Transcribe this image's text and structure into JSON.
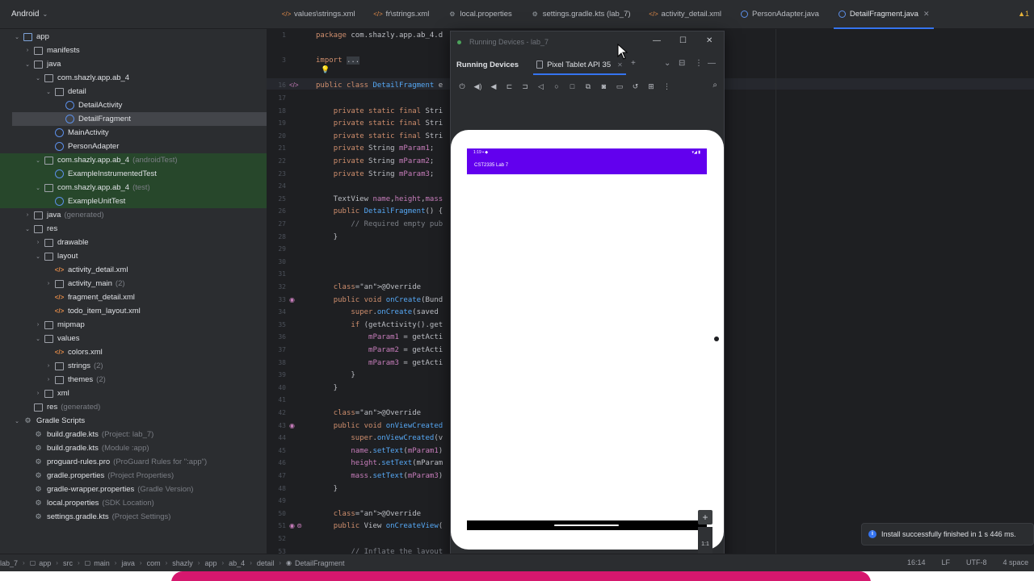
{
  "project_view": {
    "label": "Android"
  },
  "editor_tabs": [
    {
      "label": "values\\strings.xml",
      "icon": "xml-file-icon"
    },
    {
      "label": "fr\\strings.xml",
      "icon": "xml-file-icon"
    },
    {
      "label": "local.properties",
      "icon": "properties-file-icon"
    },
    {
      "label": "settings.gradle.kts (lab_7)",
      "icon": "gradle-file-icon"
    },
    {
      "label": "activity_detail.xml",
      "icon": "xml-file-icon"
    },
    {
      "label": "PersonAdapter.java",
      "icon": "java-class-icon"
    },
    {
      "label": "DetailFragment.java",
      "icon": "java-class-icon",
      "active": true
    }
  ],
  "warning_badge": "▲1",
  "tree": [
    {
      "label": "app",
      "sub": "",
      "icon": "module",
      "depth": 1,
      "arrow": "v"
    },
    {
      "label": "manifests",
      "sub": "",
      "icon": "folder",
      "depth": 2,
      "arrow": ">"
    },
    {
      "label": "java",
      "sub": "",
      "icon": "folder",
      "depth": 2,
      "arrow": "v"
    },
    {
      "label": "com.shazly.app.ab_4",
      "sub": "",
      "icon": "pkg",
      "depth": 3,
      "arrow": "v"
    },
    {
      "label": "detail",
      "sub": "",
      "icon": "pkg",
      "depth": 4,
      "arrow": "v"
    },
    {
      "label": "DetailActivity",
      "sub": "",
      "icon": "cls",
      "depth": 5,
      "arrow": ""
    },
    {
      "label": "DetailFragment",
      "sub": "",
      "icon": "cls",
      "depth": 5,
      "arrow": "",
      "selected": true
    },
    {
      "label": "MainActivity",
      "sub": "",
      "icon": "cls",
      "depth": 4,
      "arrow": ""
    },
    {
      "label": "PersonAdapter",
      "sub": "",
      "icon": "cls",
      "depth": 4,
      "arrow": ""
    },
    {
      "label": "com.shazly.app.ab_4",
      "sub": "(androidTest)",
      "icon": "pkg",
      "depth": 3,
      "arrow": "v",
      "test": true
    },
    {
      "label": "ExampleInstrumentedTest",
      "sub": "",
      "icon": "cls",
      "depth": 4,
      "arrow": "",
      "test": true
    },
    {
      "label": "com.shazly.app.ab_4",
      "sub": "(test)",
      "icon": "pkg",
      "depth": 3,
      "arrow": "v",
      "test": true
    },
    {
      "label": "ExampleUnitTest",
      "sub": "",
      "icon": "cls",
      "depth": 4,
      "arrow": "",
      "test": true
    },
    {
      "label": "java",
      "sub": "(generated)",
      "icon": "folder",
      "depth": 2,
      "arrow": ">"
    },
    {
      "label": "res",
      "sub": "",
      "icon": "folder",
      "depth": 2,
      "arrow": "v"
    },
    {
      "label": "drawable",
      "sub": "",
      "icon": "folder",
      "depth": 3,
      "arrow": ">"
    },
    {
      "label": "layout",
      "sub": "",
      "icon": "folder",
      "depth": 3,
      "arrow": "v"
    },
    {
      "label": "activity_detail.xml",
      "sub": "",
      "icon": "xml",
      "depth": 4,
      "arrow": ""
    },
    {
      "label": "activity_main",
      "sub": "(2)",
      "icon": "folder",
      "depth": 4,
      "arrow": ">"
    },
    {
      "label": "fragment_detail.xml",
      "sub": "",
      "icon": "xml",
      "depth": 4,
      "arrow": ""
    },
    {
      "label": "todo_item_layout.xml",
      "sub": "",
      "icon": "xml",
      "depth": 4,
      "arrow": ""
    },
    {
      "label": "mipmap",
      "sub": "",
      "icon": "folder",
      "depth": 3,
      "arrow": ">"
    },
    {
      "label": "values",
      "sub": "",
      "icon": "folder",
      "depth": 3,
      "arrow": "v"
    },
    {
      "label": "colors.xml",
      "sub": "",
      "icon": "xml",
      "depth": 4,
      "arrow": ""
    },
    {
      "label": "strings",
      "sub": "(2)",
      "icon": "folder",
      "depth": 4,
      "arrow": ">"
    },
    {
      "label": "themes",
      "sub": "(2)",
      "icon": "folder",
      "depth": 4,
      "arrow": ">"
    },
    {
      "label": "xml",
      "sub": "",
      "icon": "folder",
      "depth": 3,
      "arrow": ">"
    },
    {
      "label": "res",
      "sub": "(generated)",
      "icon": "folder",
      "depth": 2,
      "arrow": ""
    },
    {
      "label": "Gradle Scripts",
      "sub": "",
      "icon": "gradle",
      "depth": 1,
      "arrow": "v"
    },
    {
      "label": "build.gradle.kts",
      "sub": "(Project: lab_7)",
      "icon": "gradle",
      "depth": 2,
      "arrow": ""
    },
    {
      "label": "build.gradle.kts",
      "sub": "(Module :app)",
      "icon": "gradle",
      "depth": 2,
      "arrow": ""
    },
    {
      "label": "proguard-rules.pro",
      "sub": "(ProGuard Rules for \":app\")",
      "icon": "gradle",
      "depth": 2,
      "arrow": ""
    },
    {
      "label": "gradle.properties",
      "sub": "(Project Properties)",
      "icon": "gear",
      "depth": 2,
      "arrow": ""
    },
    {
      "label": "gradle-wrapper.properties",
      "sub": "(Gradle Version)",
      "icon": "gear",
      "depth": 2,
      "arrow": ""
    },
    {
      "label": "local.properties",
      "sub": "(SDK Location)",
      "icon": "gear",
      "depth": 2,
      "arrow": ""
    },
    {
      "label": "settings.gradle.kts",
      "sub": "(Project Settings)",
      "icon": "gradle",
      "depth": 2,
      "arrow": ""
    }
  ],
  "code_lines": [
    {
      "n": "1",
      "text": "package com.shazly.app.ab_4.d"
    },
    {
      "n": "",
      "text": ""
    },
    {
      "n": "3",
      "text": "import ..."
    },
    {
      "n": "",
      "text": ""
    },
    {
      "n": "16",
      "text": "public class DetailFragment e",
      "mark": "</>"
    },
    {
      "n": "17",
      "text": ""
    },
    {
      "n": "18",
      "text": "    private static final Stri"
    },
    {
      "n": "19",
      "text": "    private static final Stri"
    },
    {
      "n": "20",
      "text": "    private static final Stri"
    },
    {
      "n": "21",
      "text": "    private String mParam1;"
    },
    {
      "n": "22",
      "text": "    private String mParam2;"
    },
    {
      "n": "23",
      "text": "    private String mParam3;"
    },
    {
      "n": "24",
      "text": ""
    },
    {
      "n": "25",
      "text": "    TextView name,height,mass"
    },
    {
      "n": "26",
      "text": "    public DetailFragment() {"
    },
    {
      "n": "27",
      "text": "        // Required empty pub"
    },
    {
      "n": "28",
      "text": "    }"
    },
    {
      "n": "29",
      "text": ""
    },
    {
      "n": "30",
      "text": ""
    },
    {
      "n": "31",
      "text": ""
    },
    {
      "n": "32",
      "text": "    @Override"
    },
    {
      "n": "33",
      "text": "    public void onCreate(Bund",
      "mark": "o"
    },
    {
      "n": "34",
      "text": "        super.onCreate(saved"
    },
    {
      "n": "35",
      "text": "        if (getActivity().get"
    },
    {
      "n": "36",
      "text": "            mParam1 = getActi"
    },
    {
      "n": "37",
      "text": "            mParam2 = getActi"
    },
    {
      "n": "38",
      "text": "            mParam3 = getActi"
    },
    {
      "n": "39",
      "text": "        }"
    },
    {
      "n": "40",
      "text": "    }"
    },
    {
      "n": "41",
      "text": ""
    },
    {
      "n": "42",
      "text": "    @Override"
    },
    {
      "n": "43",
      "text": "    public void onViewCreated",
      "mark": "o"
    },
    {
      "n": "44",
      "text": "        super.onViewCreated(v"
    },
    {
      "n": "45",
      "text": "        name.setText(mParam1)"
    },
    {
      "n": "46",
      "text": "        height.setText(mParam"
    },
    {
      "n": "47",
      "text": "        mass.setText(mParam3)"
    },
    {
      "n": "48",
      "text": "    }"
    },
    {
      "n": "49",
      "text": ""
    },
    {
      "n": "50",
      "text": "    @Override"
    },
    {
      "n": "51",
      "text": "    public View onCreateView(",
      "mark": "o@"
    },
    {
      "n": "52",
      "text": ""
    },
    {
      "n": "53",
      "text": "        // Inflate the layout"
    }
  ],
  "running_devices": {
    "window_title": "Running Devices - lab_7",
    "panel_label": "Running Devices",
    "device_tab": "Pixel Tablet API 35",
    "window_controls": [
      "—",
      "☐",
      "✕"
    ],
    "tab_controls": [
      "+",
      "⌄",
      "⊟",
      "⋮",
      "—"
    ],
    "toolbar_icons": [
      "power-icon",
      "volume-up-icon",
      "volume-down-icon",
      "rotate-left-icon",
      "rotate-right-icon",
      "back-icon",
      "home-icon",
      "overview-icon",
      "screenshot-icon",
      "camera-icon",
      "record-icon",
      "restore-icon",
      "layout-inspector-icon",
      "more-icon"
    ],
    "app_title": "CST2335 Lab 7",
    "status_left": "1:19 ▪ ◆",
    "status_right": "▾◢ ▮",
    "zoom_plus": "+",
    "zoom_ratio": "1:1"
  },
  "notification": {
    "message": "Install successfully finished in 1 s 446 ms."
  },
  "status_bar": {
    "breadcrumbs": [
      "lab_7",
      "app",
      "src",
      "main",
      "java",
      "com",
      "shazly",
      "app",
      "ab_4",
      "detail",
      "DetailFragment"
    ],
    "position": "16:14",
    "line_sep": "LF",
    "encoding": "UTF-8",
    "indent": "4 space"
  }
}
